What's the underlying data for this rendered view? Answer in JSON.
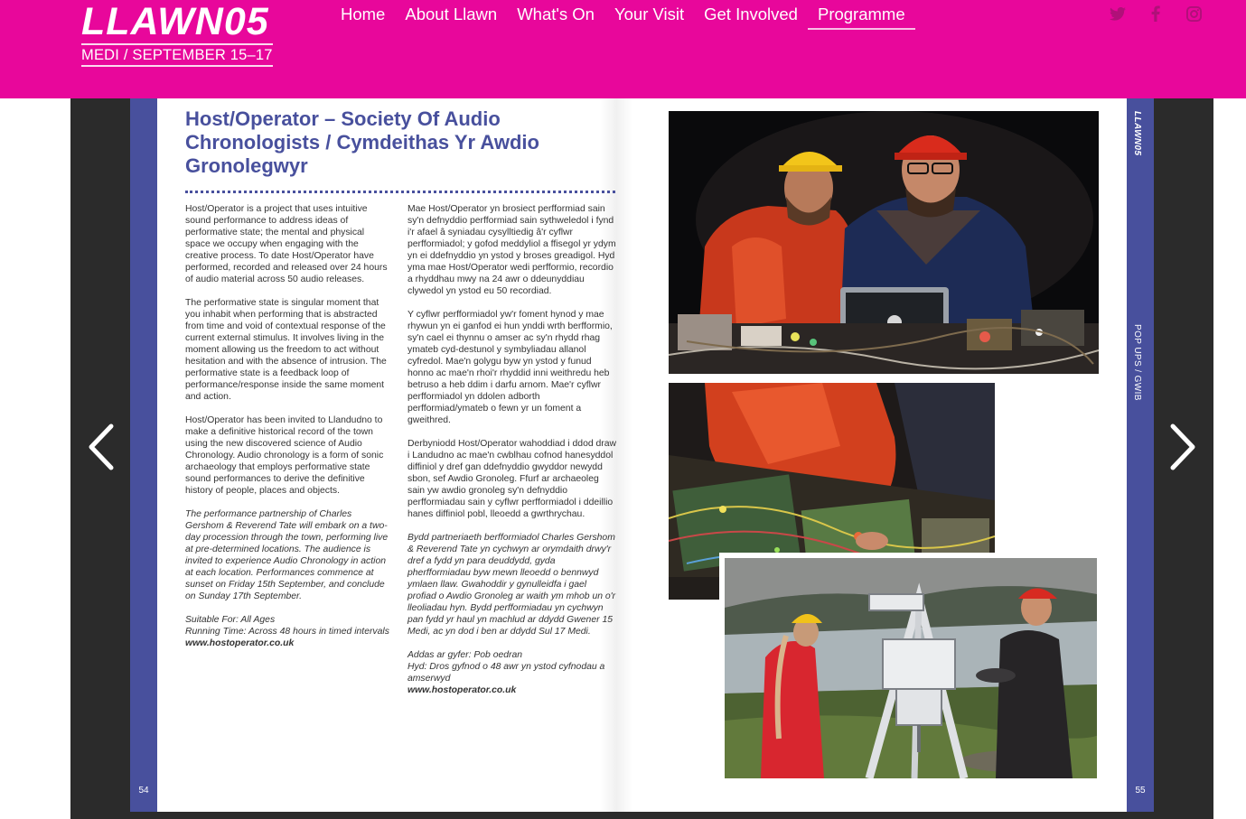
{
  "header": {
    "logo_title": "LLAWN05",
    "logo_subtitle": "MEDI / SEPTEMBER 15–17",
    "brand_color": "#e8079b",
    "nav": [
      {
        "label": "Home"
      },
      {
        "label": "About Llawn"
      },
      {
        "label": "What's On"
      },
      {
        "label": "Your Visit"
      },
      {
        "label": "Get Involved"
      },
      {
        "label": "Programme",
        "active": true
      }
    ],
    "social_icons": [
      "twitter-icon",
      "facebook-icon",
      "instagram-icon"
    ]
  },
  "viewer": {
    "prev_icon": "chevron-left-icon",
    "next_icon": "chevron-right-icon",
    "left_page_number": "54",
    "right_page_number": "55",
    "strip_logo": "LLAWN05",
    "strip_section": "POP UPS / GWIB",
    "accent_color": "#48509d"
  },
  "article": {
    "title": "Host/Operator – Society Of Audio Chronologists / Cymdeithas Yr Awdio Gronolegwyr",
    "english": {
      "p1": "Host/Operator is a project that uses intuitive sound performance to address ideas of performative state; the mental and physical space we occupy when engaging with the creative process. To date Host/Operator have performed, recorded and released over 24 hours of audio material across 50 audio releases.",
      "p2": "The performative state is singular moment that you inhabit when performing that is abstracted from time and void of contextual response of the current external stimulus. It involves living in the moment allowing us the freedom to act without hesitation and with the absence of intrusion. The performative state is a feedback loop of performance/response inside the same moment and action.",
      "p3": "Host/Operator has been invited to Llandudno to make a definitive historical record of the town using the new discovered science of Audio Chronology. Audio chronology is a form of sonic archaeology that employs performative state sound performances to derive the definitive history of people, places and objects.",
      "p4": "The performance partnership of Charles Gershom & Reverend Tate will embark on a two-day procession through the town, performing live at pre-determined locations. The audience is invited to experience Audio Chronology in action at each location. Performances commence at sunset on Friday 15th September, and conclude on Sunday 17th September.",
      "suitable": "Suitable For: All Ages",
      "running": "Running Time: Across 48 hours in timed intervals",
      "link": "www.hostoperator.co.uk"
    },
    "welsh": {
      "p1": "Mae Host/Operator yn brosiect perfformiad sain sy'n defnyddio perfformiad sain sythweledol i fynd i'r afael â syniadau cysylltiedig â'r cyflwr perfformiadol; y gofod meddyliol a ffisegol yr ydym yn ei ddefnyddio yn ystod y broses greadigol. Hyd yma mae Host/Operator wedi perfformio, recordio a rhyddhau mwy na 24 awr o ddeunyddiau clywedol yn ystod eu 50 recordiad.",
      "p2": "Y cyflwr perfformiadol yw'r foment hynod y mae rhywun yn ei ganfod ei hun ynddi wrth berfformio, sy'n cael ei thynnu o amser ac sy'n rhydd rhag ymateb cyd-destunol y symbyliadau allanol cyfredol. Mae'n golygu byw yn ystod y funud honno ac mae'n rhoi'r rhyddid inni weithredu heb betruso a heb ddim i darfu arnom. Mae'r cyflwr perfformiadol yn ddolen adborth perfformiad/ymateb o fewn yr un foment a gweithred.",
      "p3": "Derbyniodd Host/Operator wahoddiad i ddod draw i Landudno ac mae'n cwblhau cofnod hanesyddol diffiniol y dref gan ddefnyddio gwyddor newydd sbon, sef Awdio Gronoleg. Ffurf ar archaeoleg sain yw awdio gronoleg sy'n defnyddio perfformiadau sain y cyflwr perfformiadol i ddeillio hanes diffiniol pobl, lleoedd a gwrthrychau.",
      "p4": "Bydd partneriaeth berfformiadol Charles Gershom & Reverend Tate yn cychwyn ar orymdaith drwy'r dref a fydd yn para deuddydd, gyda pherfformiadau byw mewn lleoedd o bennwyd ymlaen llaw. Gwahoddir y gynulleidfa i gael profiad o Awdio Gronoleg ar waith ym mhob un o'r lleoliadau hyn. Bydd perfformiadau yn cychwyn pan fydd yr haul yn machlud ar ddydd Gwener 15 Medi, ac yn dod i ben ar ddydd Sul 17 Medi.",
      "suitable": "Addas ar gyfer: Pob oedran",
      "running": "Hyd: Dros gyfnod o 48 awr yn ystod cyfnodau a amserwyd",
      "link": "www.hostoperator.co.uk"
    }
  }
}
